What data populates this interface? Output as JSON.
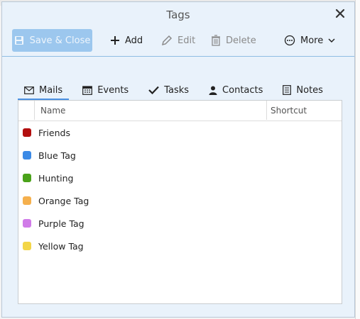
{
  "dialog": {
    "title": "Tags",
    "close_label": "✕"
  },
  "toolbar": {
    "save_label": "Save & Close",
    "add_label": "Add",
    "edit_label": "Edit",
    "delete_label": "Delete",
    "more_label": "More"
  },
  "tabs": [
    {
      "label": "Mails",
      "icon": "envelope-icon",
      "active": true
    },
    {
      "label": "Events",
      "icon": "calendar-icon",
      "active": false
    },
    {
      "label": "Tasks",
      "icon": "check-icon",
      "active": false
    },
    {
      "label": "Contacts",
      "icon": "person-icon",
      "active": false
    },
    {
      "label": "Notes",
      "icon": "note-icon",
      "active": false
    }
  ],
  "table": {
    "headers": {
      "name": "Name",
      "shortcut": "Shortcut"
    },
    "rows": [
      {
        "name": "Friends",
        "color": "#b20f0f",
        "shortcut": ""
      },
      {
        "name": "Blue Tag",
        "color": "#3b8ae6",
        "shortcut": ""
      },
      {
        "name": "Hunting",
        "color": "#4aa21a",
        "shortcut": ""
      },
      {
        "name": "Orange Tag",
        "color": "#f5b04d",
        "shortcut": ""
      },
      {
        "name": "Purple Tag",
        "color": "#d07be8",
        "shortcut": ""
      },
      {
        "name": "Yellow Tag",
        "color": "#f3d648",
        "shortcut": ""
      }
    ]
  },
  "colors": {
    "accent": "#4a90e2",
    "save_button_bg": "#9cc7ee",
    "dialog_bg": "#e9f2fb"
  }
}
